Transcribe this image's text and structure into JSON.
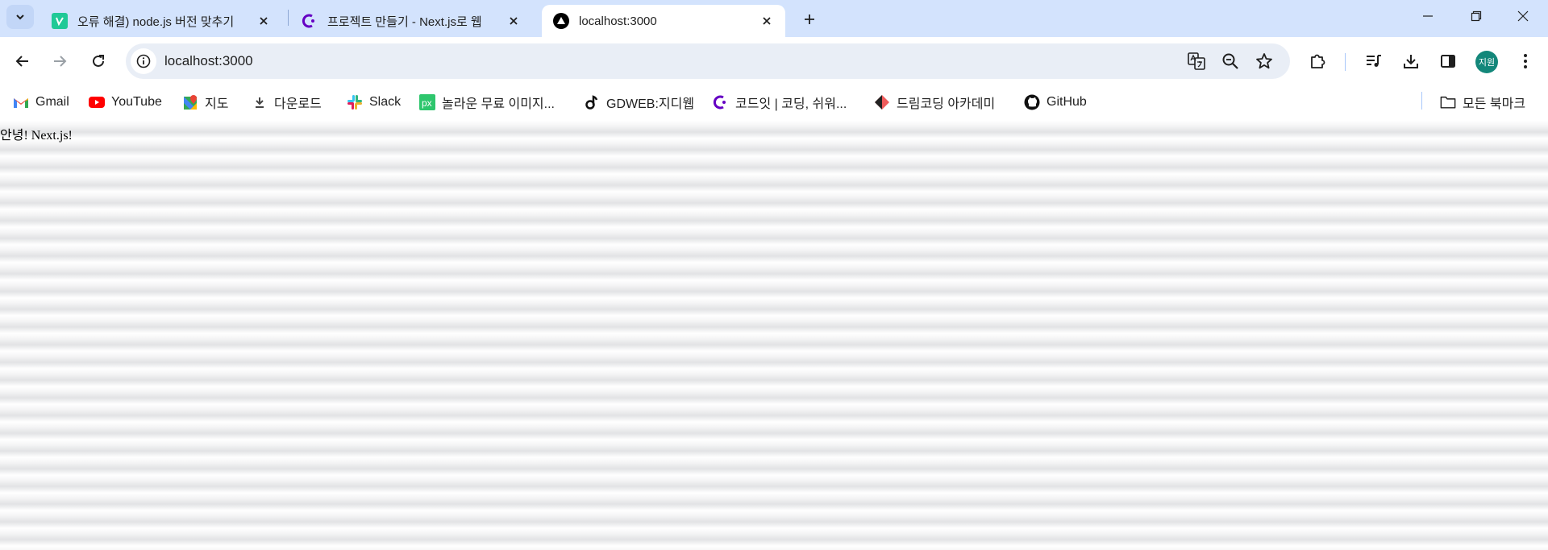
{
  "browser": {
    "tabs": [
      {
        "title": "오류 해결) node.js 버전 맞추기",
        "favicon": "velog-icon",
        "active": false
      },
      {
        "title": "프로젝트 만들기 - Next.js로 웹",
        "favicon": "codeit-icon",
        "active": false
      },
      {
        "title": "localhost:3000",
        "favicon": "nextjs-triangle-icon",
        "active": true
      }
    ],
    "address_bar": {
      "url": "localhost:3000"
    },
    "profile_avatar": "지원",
    "bookmarks": [
      {
        "label": "Gmail",
        "icon": "gmail-icon"
      },
      {
        "label": "YouTube",
        "icon": "youtube-icon"
      },
      {
        "label": "지도",
        "icon": "maps-icon"
      },
      {
        "label": "다운로드",
        "icon": "download-icon"
      },
      {
        "label": "Slack",
        "icon": "slack-icon"
      },
      {
        "label": "놀라운 무료 이미지...",
        "icon": "pixabay-icon"
      },
      {
        "label": "GDWEB:지디웹",
        "icon": "gdweb-icon"
      },
      {
        "label": "코드잇 | 코딩, 쉬워...",
        "icon": "codeit-icon"
      },
      {
        "label": "드림코딩 아카데미",
        "icon": "dreamcoding-icon"
      },
      {
        "label": "GitHub",
        "icon": "github-icon"
      }
    ],
    "all_bookmarks": "모든 북마크"
  },
  "page": {
    "text": "안녕! Next.js!"
  },
  "colors": {
    "tabstrip_bg": "#d3e3fd",
    "omnibox_bg": "#e9eef6",
    "avatar_bg": "#13877a"
  }
}
